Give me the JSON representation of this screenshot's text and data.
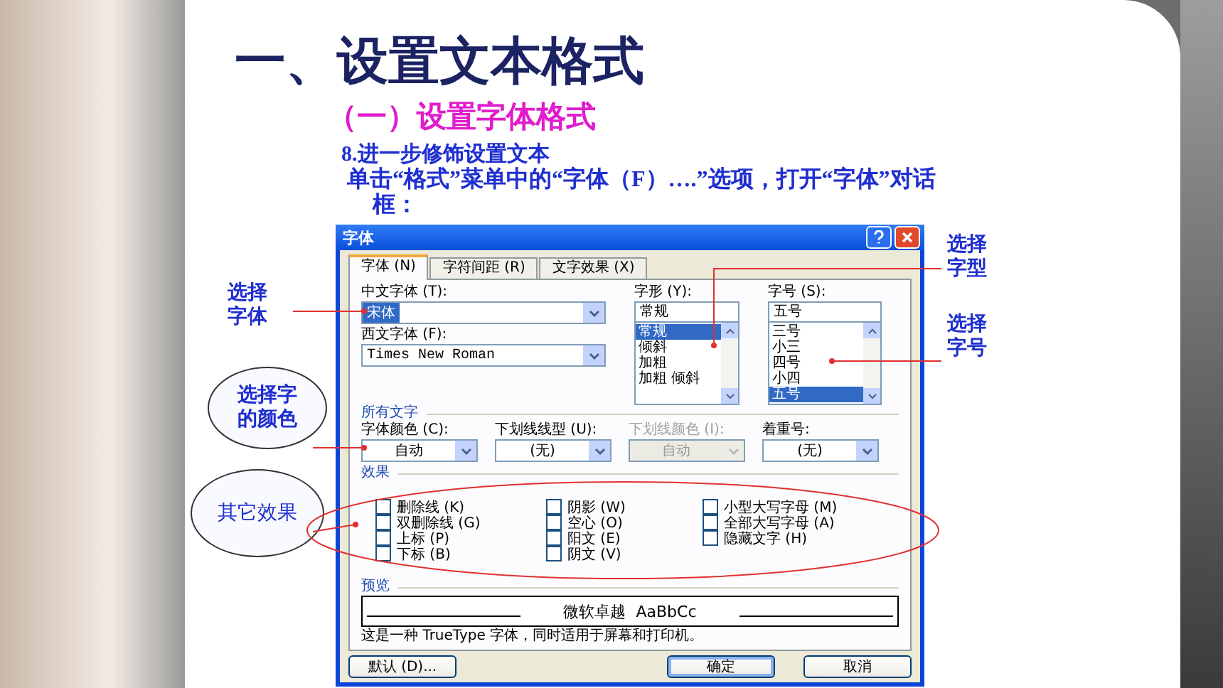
{
  "slide": {
    "title": "一、设置文本格式",
    "subtitle": "（一）设置字体格式",
    "step": "8.进一步修饰设置文本",
    "instruction": "单击“格式”菜单中的“字体（F）….”选项，打开“字体”对话框："
  },
  "dialog": {
    "title": "字体",
    "tabs": [
      {
        "label": "字体 (N)",
        "selected": true
      },
      {
        "label": "字符间距 (R)",
        "selected": false
      },
      {
        "label": "文字效果 (X)",
        "selected": false
      }
    ],
    "chinese_font": {
      "label": "中文字体 (T):",
      "value": "宋体",
      "highlighted": true
    },
    "western_font": {
      "label": "西文字体 (F):",
      "value": "Times New Roman",
      "highlighted": false
    },
    "style": {
      "label": "字形 (Y):",
      "value": "常规",
      "options": [
        {
          "label": "常规",
          "selected": true
        },
        {
          "label": "倾斜",
          "selected": false
        },
        {
          "label": "加粗",
          "selected": false
        },
        {
          "label": "加粗 倾斜",
          "selected": false
        }
      ]
    },
    "size": {
      "label": "字号 (S):",
      "value": "五号",
      "options": [
        {
          "label": "三号",
          "selected": false
        },
        {
          "label": "小三",
          "selected": false
        },
        {
          "label": "四号",
          "selected": false
        },
        {
          "label": "小四",
          "selected": false
        },
        {
          "label": "五号",
          "selected": true
        }
      ]
    },
    "all_text": {
      "heading": "所有文字",
      "fields": [
        {
          "label": "字体颜色 (C):",
          "value": "自动",
          "disabled": false
        },
        {
          "label": "下划线线型 (U):",
          "value": "(无)",
          "disabled": false
        },
        {
          "label": "下划线颜色 (I):",
          "value": "自动",
          "disabled": true
        },
        {
          "label": "着重号:",
          "value": "(无)",
          "disabled": false
        }
      ]
    },
    "effects": {
      "heading": "效果",
      "columns": [
        [
          {
            "label": "删除线 (K)",
            "checked": false
          },
          {
            "label": "双删除线 (G)",
            "checked": false
          },
          {
            "label": "上标 (P)",
            "checked": false
          },
          {
            "label": "下标 (B)",
            "checked": false
          }
        ],
        [
          {
            "label": "阴影 (W)",
            "checked": false
          },
          {
            "label": "空心 (O)",
            "checked": false
          },
          {
            "label": "阳文 (E)",
            "checked": false
          },
          {
            "label": "阴文 (V)",
            "checked": false
          }
        ],
        [
          {
            "label": "小型大写字母 (M)",
            "checked": false
          },
          {
            "label": "全部大写字母 (A)",
            "checked": false
          },
          {
            "label": "隐藏文字 (H)",
            "checked": false
          }
        ]
      ]
    },
    "preview": {
      "heading": "预览",
      "sample": "微软卓越  AaBbCc"
    },
    "note": "这是一种 TrueType 字体，同时适用于屏幕和打印机。",
    "buttons": [
      {
        "label": "默认 (D)...",
        "default": false
      },
      {
        "label": "确定",
        "default": true
      },
      {
        "label": "取消",
        "default": false
      }
    ]
  },
  "left_callouts": [
    {
      "text": "选择字体",
      "kind": "plain"
    },
    {
      "text": "选择字的颜色",
      "kind": "circled"
    },
    {
      "text": "其它效果",
      "kind": "circled"
    }
  ],
  "right_callouts": [
    {
      "text": "选择字型",
      "kind": "plain"
    },
    {
      "text": "选择字号",
      "kind": "plain"
    }
  ]
}
